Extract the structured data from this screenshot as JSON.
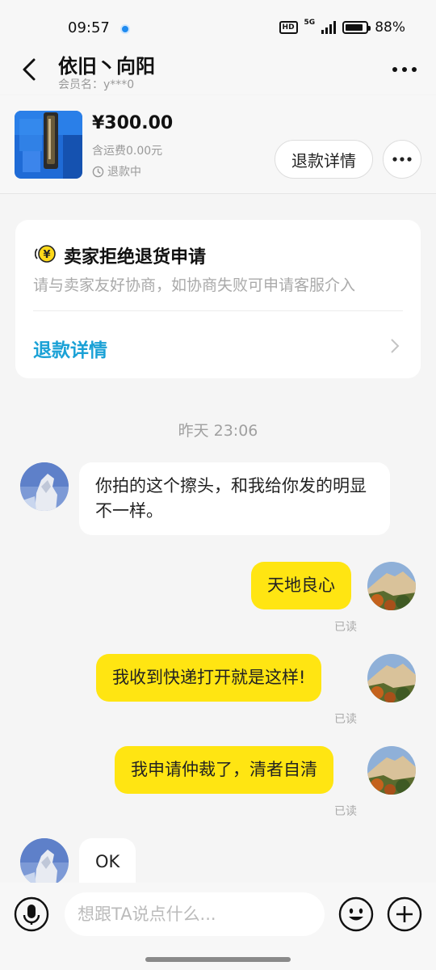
{
  "status_bar": {
    "time": "09:57",
    "hd": "HD",
    "network": "5G",
    "battery": "88%",
    "battery_level": 0.88
  },
  "header": {
    "title": "依旧丶向阳",
    "subtitle": "会员名：y***0"
  },
  "product": {
    "price": "¥300.00",
    "shipping": "含运费0.00元",
    "status": "退款中",
    "refund_button": "退款详情"
  },
  "notice": {
    "title": "卖家拒绝退货申请",
    "description": "请与卖家友好协商，如协商失败可申请客服介入",
    "link": "退款详情"
  },
  "chat": {
    "timestamp": "昨天 23:06",
    "messages": [
      {
        "direction": "in",
        "text": "你拍的这个擦头，和我给你发的明显不一样。"
      },
      {
        "direction": "out",
        "text": "天地良心",
        "status": "已读"
      },
      {
        "direction": "out",
        "text": "我收到快递打开就是这样!",
        "status": "已读"
      },
      {
        "direction": "out",
        "text": "我申请仲裁了，清者自清",
        "status": "已读"
      },
      {
        "direction": "in",
        "text": "OK"
      }
    ]
  },
  "input_bar": {
    "placeholder": "想跟TA说点什么..."
  },
  "colors": {
    "accent_link": "#1aa1d6",
    "outgoing_bubble": "#ffe512",
    "incoming_bubble": "#ffffff",
    "background": "#f5f5f5"
  },
  "icons": [
    "back-arrow-icon",
    "more-icon",
    "clock-icon",
    "refund-coin-icon",
    "chevron-right-icon",
    "voice-icon",
    "emoji-icon",
    "plus-icon"
  ]
}
